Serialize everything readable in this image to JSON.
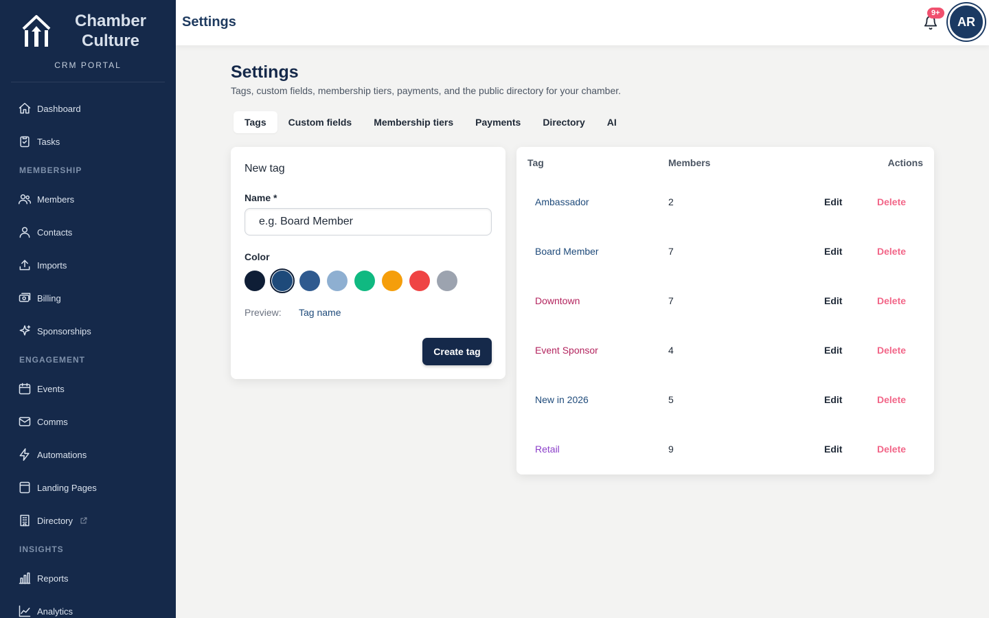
{
  "brand": {
    "name_line1": "Chamber",
    "name_line2": "Culture",
    "subtitle": "CRM PORTAL"
  },
  "sidebar": {
    "items": [
      {
        "type": "item",
        "label": "Dashboard",
        "icon": "home-icon"
      },
      {
        "type": "item",
        "label": "Tasks",
        "icon": "clipboard-check-icon"
      },
      {
        "type": "section",
        "label": "MEMBERSHIP"
      },
      {
        "type": "item",
        "label": "Members",
        "icon": "users-icon"
      },
      {
        "type": "item",
        "label": "Contacts",
        "icon": "user-icon"
      },
      {
        "type": "item",
        "label": "Imports",
        "icon": "upload-icon"
      },
      {
        "type": "item",
        "label": "Billing",
        "icon": "billing-icon"
      },
      {
        "type": "item",
        "label": "Sponsorships",
        "icon": "sparkles-icon"
      },
      {
        "type": "section",
        "label": "ENGAGEMENT"
      },
      {
        "type": "item",
        "label": "Events",
        "icon": "calendar-icon"
      },
      {
        "type": "item",
        "label": "Comms",
        "icon": "mail-icon"
      },
      {
        "type": "item",
        "label": "Automations",
        "icon": "bolt-icon"
      },
      {
        "type": "item",
        "label": "Landing Pages",
        "icon": "page-icon"
      },
      {
        "type": "item",
        "label": "Directory",
        "icon": "building-icon",
        "external": true
      },
      {
        "type": "section",
        "label": "INSIGHTS"
      },
      {
        "type": "item",
        "label": "Reports",
        "icon": "bar-chart-icon"
      },
      {
        "type": "item",
        "label": "Analytics",
        "icon": "line-chart-icon"
      }
    ]
  },
  "topbar": {
    "title": "Settings",
    "notification_badge": "9+",
    "avatar_initials": "AR"
  },
  "page": {
    "title": "Settings",
    "subtitle": "Tags, custom fields, membership tiers, payments, and the public directory for your chamber."
  },
  "tabs": [
    {
      "label": "Tags",
      "active": true
    },
    {
      "label": "Custom fields",
      "active": false
    },
    {
      "label": "Membership tiers",
      "active": false
    },
    {
      "label": "Payments",
      "active": false
    },
    {
      "label": "Directory",
      "active": false
    },
    {
      "label": "AI",
      "active": false
    }
  ],
  "new_tag": {
    "title": "New tag",
    "name_label": "Name *",
    "name_placeholder": "e.g. Board Member",
    "color_label": "Color",
    "colors": [
      "#0f1e36",
      "#1e4a7a",
      "#2f5a8f",
      "#8eafd1",
      "#10b981",
      "#f59e0b",
      "#ef4444",
      "#9ca3af"
    ],
    "selected_color_index": 1,
    "preview_label": "Preview:",
    "preview_tag": "Tag name",
    "create_button": "Create tag"
  },
  "tags_table": {
    "headers": {
      "tag": "Tag",
      "members": "Members",
      "actions": "Actions"
    },
    "edit_label": "Edit",
    "delete_label": "Delete",
    "rows": [
      {
        "name": "Ambassador",
        "count": "2",
        "color": "#1e4a7a"
      },
      {
        "name": "Board Member",
        "count": "7",
        "color": "#1e4a7a"
      },
      {
        "name": "Downtown",
        "count": "7",
        "color": "#b3245e"
      },
      {
        "name": "Event Sponsor",
        "count": "4",
        "color": "#b3245e"
      },
      {
        "name": "New in 2026",
        "count": "5",
        "color": "#1e4a7a"
      },
      {
        "name": "Retail",
        "count": "9",
        "color": "#8b3fc9"
      }
    ]
  }
}
